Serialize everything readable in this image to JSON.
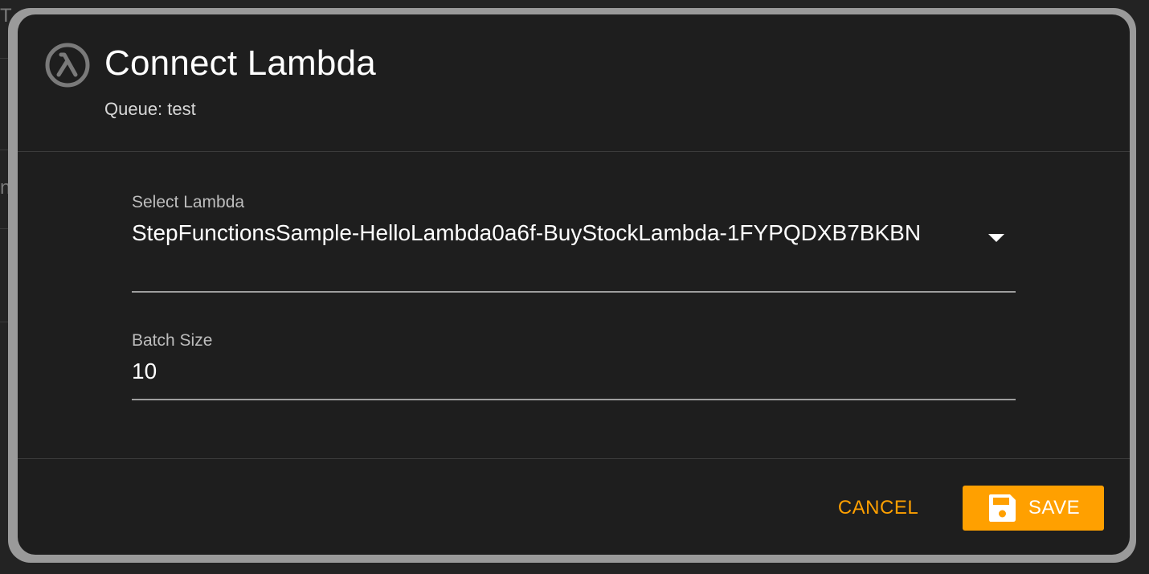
{
  "background": {
    "partial_text_top": "T",
    "partial_text_mid": "n"
  },
  "dialog": {
    "title": "Connect Lambda",
    "subtitle": "Queue: test",
    "icon": "lambda-icon",
    "accent_color": "#ffa000"
  },
  "form": {
    "lambda": {
      "label": "Select Lambda",
      "value": "StepFunctionsSample-HelloLambda0a6f-BuyStockLambda-1FYPQDXB7BKBN"
    },
    "batch_size": {
      "label": "Batch Size",
      "value": "10"
    }
  },
  "actions": {
    "cancel_label": "CANCEL",
    "save_label": "SAVE",
    "save_icon": "floppy-disk-icon"
  }
}
